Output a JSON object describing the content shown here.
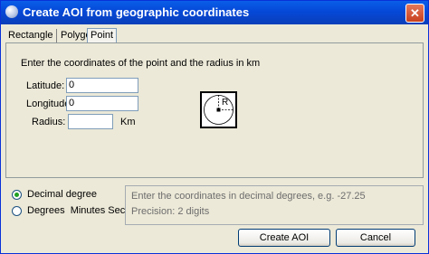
{
  "window": {
    "title": "Create AOI from geographic coordinates",
    "close_glyph": "✕"
  },
  "tabs": [
    {
      "label": "Rectangle",
      "active": false
    },
    {
      "label": "Polygon",
      "active": false
    },
    {
      "label": "Point",
      "active": true
    }
  ],
  "point_panel": {
    "instruction": "Enter the coordinates of the point and the radius in km",
    "latitude": {
      "label": "Latitude:",
      "value": "0"
    },
    "longitude": {
      "label": "Longitude:",
      "value": "0"
    },
    "radius": {
      "label": "Radius:",
      "value": "",
      "unit": "Km"
    },
    "diagram": {
      "radius_label": "R"
    }
  },
  "format_options": {
    "decimal": {
      "label": "Decimal degree",
      "selected": true
    },
    "dms": {
      "label": "Degrees  Minutes Second",
      "selected": false
    }
  },
  "info": {
    "line1": "Enter the coordinates in decimal degrees, e.g. -27.25",
    "line2": "Precision: 2 digits"
  },
  "buttons": {
    "create": "Create AOI",
    "cancel": "Cancel"
  }
}
